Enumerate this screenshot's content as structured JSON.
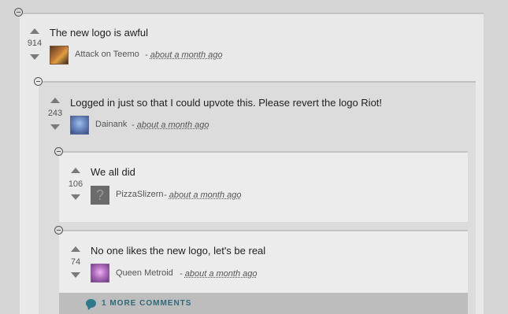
{
  "comments": [
    {
      "text": "The new logo is awful",
      "score": "914",
      "author": "Attack on Teemo",
      "time_prefix": "-",
      "time": "about a month ago"
    },
    {
      "text": "Logged in just so that I could upvote this. Please revert the logo Riot!",
      "score": "243",
      "author": "Dainank",
      "time_prefix": "-",
      "time": "about a month ago"
    },
    {
      "text": "We all did",
      "score": "106",
      "author": "PizzaSlizern",
      "time_prefix": "-",
      "time": "about a month ago",
      "avatar_glyph": "?"
    },
    {
      "text": "No one likes the new logo, let's be real",
      "score": "74",
      "author": "Queen Metroid",
      "time_prefix": "-",
      "time": "about a month ago"
    }
  ],
  "more_comments": {
    "label": "1 MORE COMMENTS",
    "icon": "speech-bubble-icon",
    "color": "#2e7a8a"
  },
  "colors": {
    "page_bg": "#d6d6d6",
    "panel_bg": "#e9e9e9",
    "nested_bg": "#dcdcdc",
    "accent": "#2e6a7a"
  }
}
